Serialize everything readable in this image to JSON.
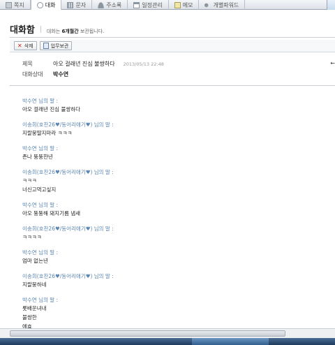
{
  "tabs": [
    {
      "label": "쪽지",
      "icon": "envelope-icon"
    },
    {
      "label": "대화",
      "icon": "chat-bubble-icon",
      "active": true
    },
    {
      "label": "문자",
      "icon": "sms-icon"
    },
    {
      "label": "주소록",
      "icon": "contacts-icon"
    },
    {
      "label": "일정관리",
      "icon": "calendar-icon"
    },
    {
      "label": "메모",
      "icon": "memo-icon"
    },
    {
      "label": "개별파워드",
      "icon": "key-icon"
    }
  ],
  "header": {
    "title": "대화함",
    "retention_prefix": "대화는 ",
    "retention_period": "6개월간",
    "retention_suffix": " 보관됩니다."
  },
  "toolbar": {
    "delete_label": "삭제",
    "save_label": "업무보관"
  },
  "meta": {
    "subject_key": "제목",
    "subject_value": "아오 걸래년 진심 불쌍하다",
    "date": "2013/05/13 22:48",
    "partner_key": "대화상대",
    "partner_value": "박수연",
    "corner_char": "←"
  },
  "messages": [
    {
      "speaker": "박수연 님의 말 :",
      "lines": [
        "아오 걸래년 진심 불쌍하다"
      ]
    },
    {
      "speaker": "이송희(호찬26♥/동어리애기♥) 님의 말 :",
      "lines": [
        "지랄뭉딸지마라 ㅋㅋㅋ"
      ]
    },
    {
      "speaker": "박수연 님의 말 :",
      "lines": [
        "존나 뚱뚱한년"
      ]
    },
    {
      "speaker": "이송희(호찬26♥/동어리애기♥) 님의 말 :",
      "lines": [
        "ㅋㅋㅋ",
        "너신고먹고싶지"
      ]
    },
    {
      "speaker": "박수연 님의 말 :",
      "lines": [
        "아오 뚱뚱해 돼지기름 냄새"
      ]
    },
    {
      "speaker": "이송희(호찬26♥/동어리애기♥) 님의 말 :",
      "lines": [
        "ㅋㅋㅋㅋ"
      ]
    },
    {
      "speaker": "박수연 님의 말 :",
      "lines": [
        "엄마 없는년"
      ]
    },
    {
      "speaker": "이송희(호찬26♥/동어리애기♥) 님의 말 :",
      "lines": [
        "지랄뭉하네"
      ]
    },
    {
      "speaker": "박수연 님의 말 :",
      "lines": [
        "롯배운녀내",
        "불쌍한",
        "에효"
      ]
    }
  ]
}
